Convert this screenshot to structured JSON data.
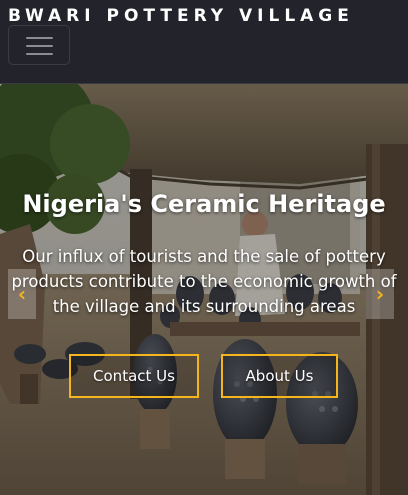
{
  "navbar": {
    "brand": "BWARI POTTERY VILLAGE",
    "toggler_icon": "hamburger-menu-icon"
  },
  "hero": {
    "heading": "Nigeria's Ceramic Heritage",
    "tagline": "Our influx of tourists and the sale of pottery products contribute to the economic growth of the village and its surrounding areas",
    "buttons": {
      "contact": "Contact Us",
      "about": "About Us"
    },
    "controls": {
      "prev_icon": "chevron-left-icon",
      "next_icon": "chevron-right-icon"
    }
  },
  "colors": {
    "accent": "#f5b51c",
    "navbar_bg": "#23232b",
    "text": "#ffffff"
  }
}
